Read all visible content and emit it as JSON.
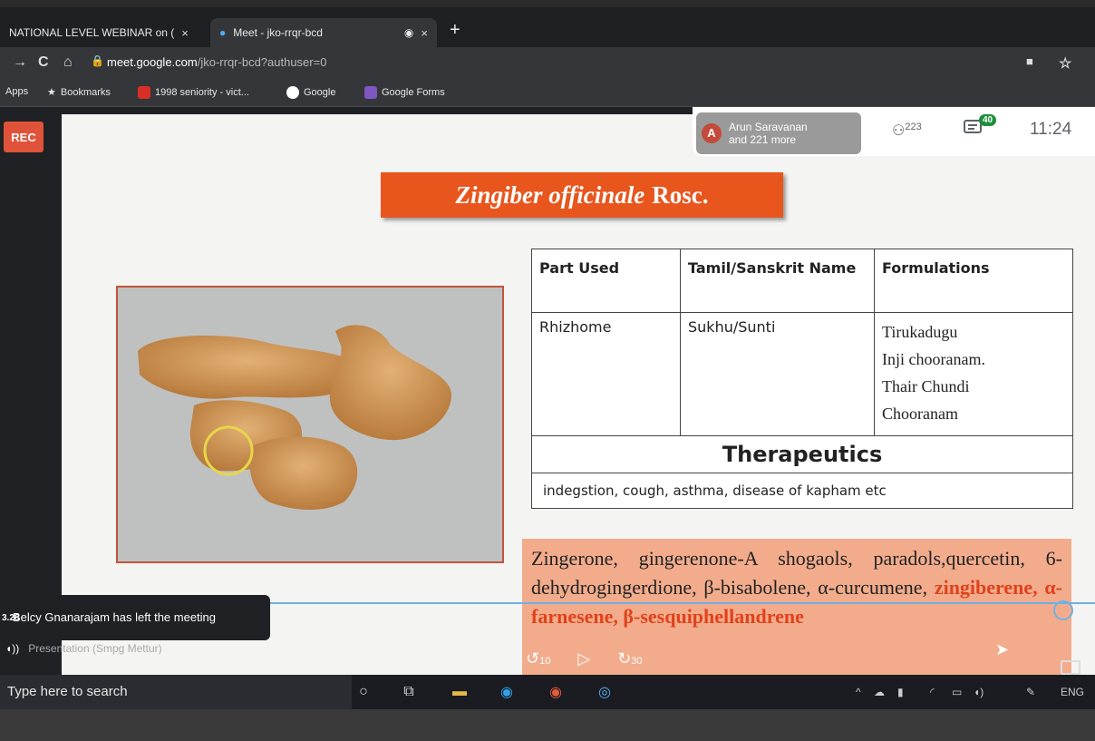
{
  "browser": {
    "tabs": [
      {
        "title": "NATIONAL LEVEL WEBINAR on (",
        "close": "×"
      },
      {
        "title": "Meet - jko-rrqr-bcd",
        "close": "×"
      }
    ],
    "new_tab": "+",
    "url_host": "meet.google.com",
    "url_path": "/jko-rrqr-bcd?authuser=0",
    "bookmarks": [
      "Apps",
      "Bookmarks",
      "1998 seniority - vict...",
      "Google",
      "Google Forms"
    ]
  },
  "meet": {
    "rec_label": "REC",
    "presenter_initial": "A",
    "presenter_name": "Arun Saravanan",
    "presenter_more": "and 221 more",
    "participants_count": "223",
    "chat_count": "40",
    "time": "11:24",
    "toast": "Belcy Gnanarajam has left the meeting",
    "presentation_label": "Presentation (Smpg Mettur)",
    "time_left": "3.28"
  },
  "slide": {
    "title_italic": "Zingiber officinale",
    "title_rest": "Rosc.",
    "table_headers": [
      "Part Used",
      "Tamil/Sanskrit Name",
      "Formulations"
    ],
    "table_row": {
      "part": "Rhizhome",
      "name": "Sukhu/Sunti",
      "formulations": [
        "Tirukadugu",
        "Inji chooranam.",
        "Thair Chundi",
        "Chooranam"
      ]
    },
    "therapeutics_heading": "Therapeutics",
    "therapeutics_text": "indegstion, cough, asthma, disease of kapham etc",
    "constituents_plain": "Zingerone, gingerenone-A shogaols, paradols,quercetin, 6-dehydrogingerdione, β-bisabolene, α-curcumene,",
    "constituents_red": "zingiberene, α-farnesene, β-sesquiphellandrene"
  },
  "player": {
    "rewind": "10",
    "forward": "30"
  },
  "taskbar": {
    "search_text": "Type here to search",
    "language": "ENG"
  }
}
